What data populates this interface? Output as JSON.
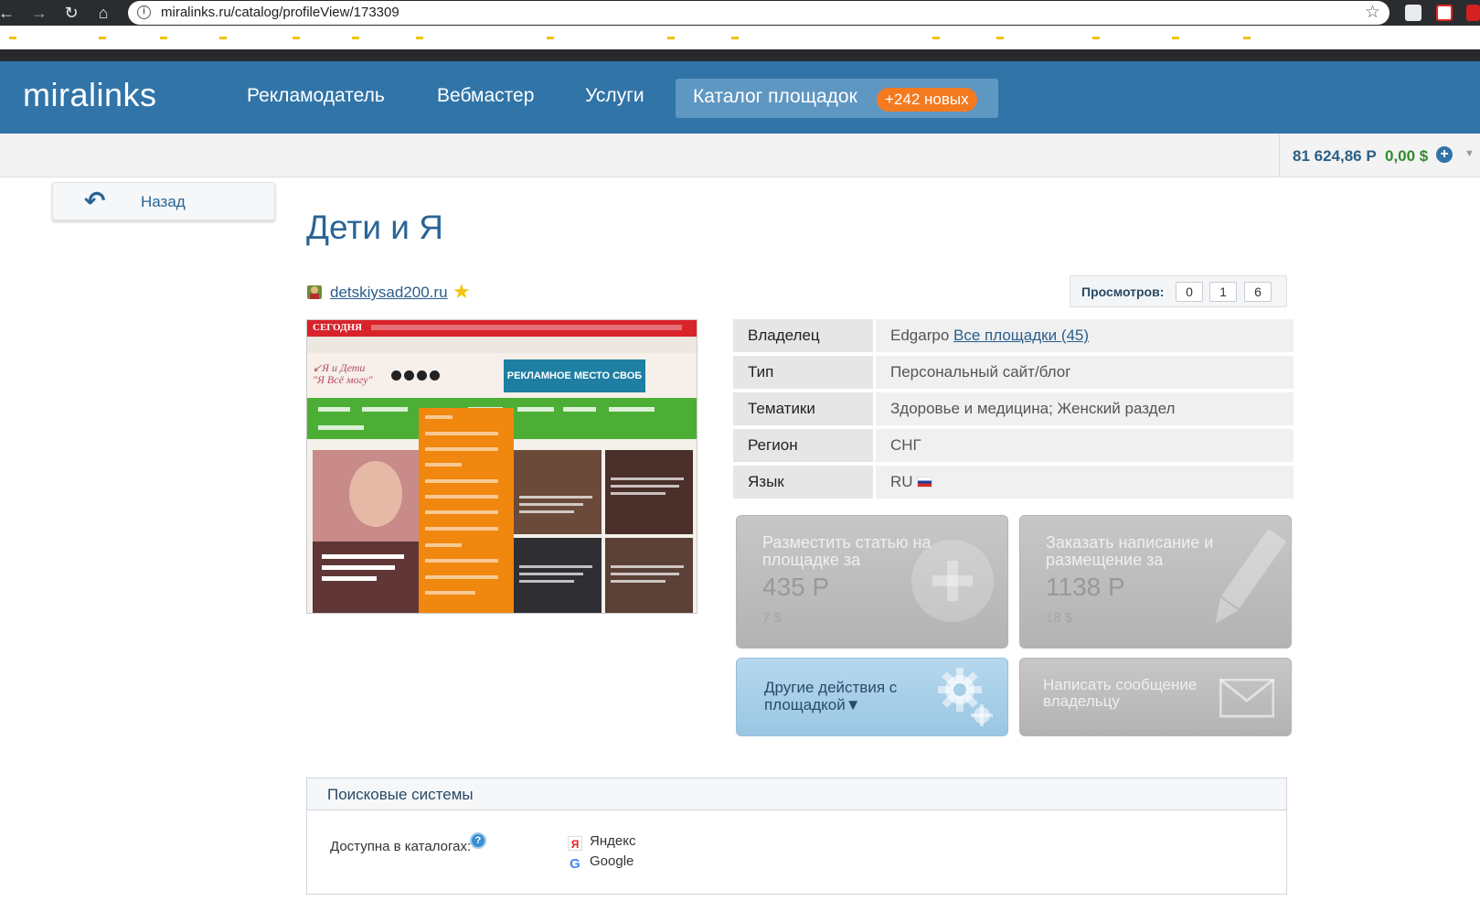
{
  "browser": {
    "url": "miralinks.ru/catalog/profileView/173309",
    "back": "←",
    "forward": "→",
    "reload": "↻",
    "home": "⌂",
    "star": "☆"
  },
  "header": {
    "logo": "miralinks",
    "nav": [
      "Рекламодатель",
      "Вебмастер",
      "Услуги"
    ],
    "catalog_label": "Каталог площадок",
    "catalog_badge": "+242 новых"
  },
  "balance": {
    "rub": "81 624,86 Р",
    "usd": "0,00 $",
    "add": "+",
    "caret": "▼"
  },
  "back_button": {
    "label": "Назад",
    "icon": "↶"
  },
  "page": {
    "title": "Дети и Я"
  },
  "site": {
    "domain": "detskiysad200.ru",
    "star": "★"
  },
  "views": {
    "label": "Просмотров:",
    "counts": [
      "0",
      "1",
      "6"
    ]
  },
  "thumbnail": {
    "brand": "СЕГОДНЯ",
    "logo_line1": "↙Я и Дети",
    "logo_line2": "\"Я Всё могу\"",
    "ad_text": "РЕКЛАМНОЕ МЕСТО СВОБ"
  },
  "info": [
    {
      "key": "Владелец",
      "value": "Edgarpo",
      "link": "Все площадки (45)"
    },
    {
      "key": "Тип",
      "value": "Персональный сайт/блог"
    },
    {
      "key": "Тематики",
      "value": "Здоровье и медицина; Женский раздел"
    },
    {
      "key": "Регион",
      "value": "СНГ"
    },
    {
      "key": "Язык",
      "value": "RU"
    }
  ],
  "actions": {
    "place_article": {
      "title": "Разместить статью на площадке за",
      "price": "435 Р",
      "usd": "7 $"
    },
    "order_writing": {
      "title": "Заказать написание и размещение за",
      "price": "1138 Р",
      "usd": "18 $"
    },
    "other_actions": {
      "title": "Другие действия с площадкой▼"
    },
    "message_owner": {
      "title": "Написать сообщение владельцу"
    }
  },
  "search_engines": {
    "title": "Поисковые системы",
    "label": "Доступна в каталогах:",
    "help": "?",
    "engines": [
      {
        "name": "Яндекс",
        "icon": "Я",
        "color": "#e52620"
      },
      {
        "name": "Google",
        "icon": "G",
        "color": "#4285f4"
      }
    ]
  },
  "colors": {
    "header": "#3174a8",
    "badge": "#f47a20",
    "link": "#2a5d8c"
  }
}
